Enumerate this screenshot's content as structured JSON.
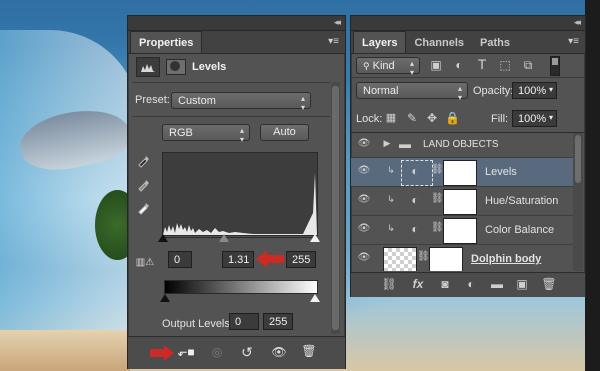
{
  "properties": {
    "tab_label": "Properties",
    "adjustment_title": "Levels",
    "preset_label": "Preset:",
    "preset_value": "Custom",
    "channel_value": "RGB",
    "auto_label": "Auto",
    "input_black": "0",
    "input_gamma": "1.31",
    "input_white": "255",
    "output_label": "Output Levels:",
    "output_black": "0",
    "output_white": "255"
  },
  "layers": {
    "tabs": [
      "Layers",
      "Channels",
      "Paths"
    ],
    "filter_kind": "Kind",
    "blend_mode": "Normal",
    "opacity_label": "Opacity:",
    "opacity_value": "100%",
    "lock_label": "Lock:",
    "fill_label": "Fill:",
    "fill_value": "100%",
    "group_name": "LAND OBJECTS",
    "rows": [
      {
        "name": "Levels"
      },
      {
        "name": "Hue/Saturation"
      },
      {
        "name": "Color Balance"
      },
      {
        "name": "Dolphin body"
      }
    ],
    "footer_fx": "fx"
  },
  "colors": {
    "panel_bg": "#535353",
    "selected_row": "#596a7e",
    "annotation_red": "#cc2a25"
  }
}
